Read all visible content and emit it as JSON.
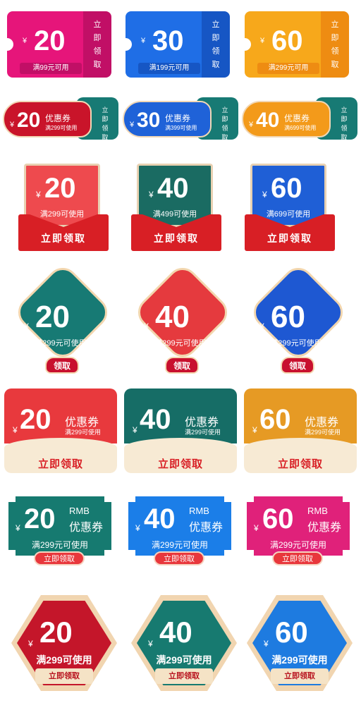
{
  "currency_symbol": "¥",
  "colors": {
    "magenta": "#e6157a",
    "blue": "#1f6ee6",
    "orange": "#f7a81b",
    "red": "#d81f25",
    "teal": "#177a74",
    "cream": "#f7ead4",
    "gold": "#f2d6ae"
  },
  "row1": [
    {
      "amount": "20",
      "condition": "满99元可用",
      "claim": [
        "立",
        "即",
        "领",
        "取"
      ]
    },
    {
      "amount": "30",
      "condition": "满199元可用",
      "claim": [
        "立",
        "即",
        "领",
        "取"
      ]
    },
    {
      "amount": "60",
      "condition": "满299元可用",
      "claim": [
        "立",
        "即",
        "领",
        "取"
      ]
    }
  ],
  "row2": [
    {
      "amount": "20",
      "label": "优惠券",
      "condition": "满299可使用",
      "claim": [
        "立",
        "即",
        "领",
        "取"
      ]
    },
    {
      "amount": "30",
      "label": "优惠券",
      "condition": "满399可使用",
      "claim": [
        "立",
        "即",
        "领",
        "取"
      ]
    },
    {
      "amount": "40",
      "label": "优惠券",
      "condition": "满699可使用",
      "claim": [
        "立",
        "即",
        "领",
        "取"
      ]
    }
  ],
  "row3": [
    {
      "amount": "20",
      "condition": "满299可使用",
      "button": "立即领取"
    },
    {
      "amount": "40",
      "condition": "满499可使用",
      "button": "立即领取"
    },
    {
      "amount": "60",
      "condition": "满699可使用",
      "button": "立即领取"
    }
  ],
  "row4": [
    {
      "amount": "20",
      "condition": "满299元可使用",
      "button": "领取"
    },
    {
      "amount": "40",
      "condition": "满299元可使用",
      "button": "领取"
    },
    {
      "amount": "60",
      "condition": "满299元可使用",
      "button": "领取"
    }
  ],
  "row5": [
    {
      "amount": "20",
      "label": "优惠券",
      "condition": "满299可使用",
      "button": "立即领取"
    },
    {
      "amount": "40",
      "label": "优惠券",
      "condition": "满299可使用",
      "button": "立即领取"
    },
    {
      "amount": "60",
      "label": "优惠券",
      "condition": "满299可使用",
      "button": "立即领取"
    }
  ],
  "row6": [
    {
      "amount": "20",
      "unit": "RMB",
      "label": "优惠券",
      "condition": "满299元可使用",
      "button": "立即领取"
    },
    {
      "amount": "40",
      "unit": "RMB",
      "label": "优惠券",
      "condition": "满299元可使用",
      "button": "立即领取"
    },
    {
      "amount": "60",
      "unit": "RMB",
      "label": "优惠券",
      "condition": "满299元可使用",
      "button": "立即领取"
    }
  ],
  "row7": [
    {
      "amount": "20",
      "condition": "满299可使用",
      "button": "立即领取"
    },
    {
      "amount": "40",
      "condition": "满299可使用",
      "button": "立即领取"
    },
    {
      "amount": "60",
      "condition": "满299可使用",
      "button": "立即领取"
    }
  ]
}
